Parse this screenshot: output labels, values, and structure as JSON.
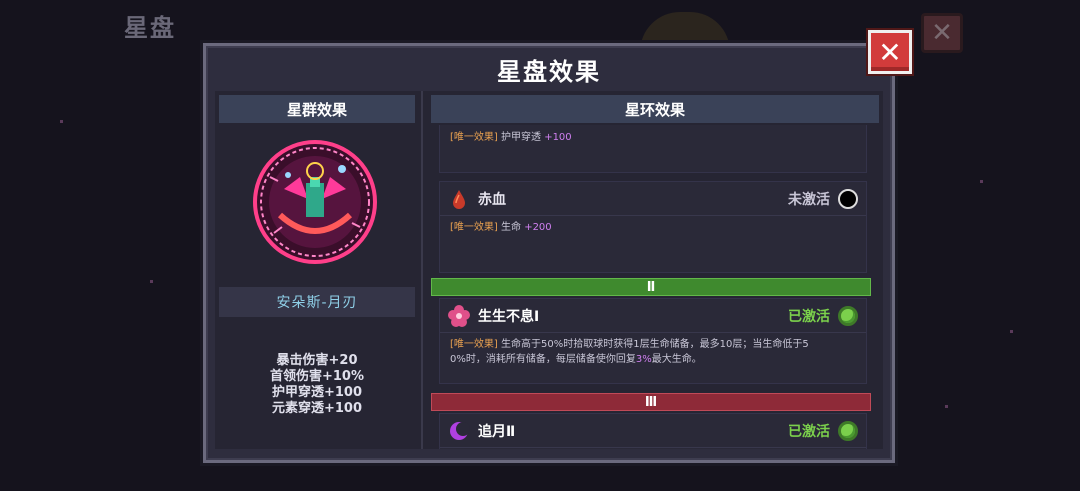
{
  "background": {
    "title": "星盘",
    "close_label": "✕"
  },
  "panel": {
    "title": "星盘效果",
    "close_label": "✕"
  },
  "left": {
    "header": "星群效果",
    "constellation_name": "安朵斯-月刃",
    "stats": [
      "暴击伤害+20",
      "首领伤害+10%",
      "护甲穿透+100",
      "元素穿透+100"
    ]
  },
  "right": {
    "header": "星环效果",
    "partial_entry": {
      "tag": "[唯一效果]",
      "text": "护甲穿透",
      "value": "+100"
    },
    "entries": [
      {
        "icon": "blood-drop-icon",
        "name": "赤血",
        "status": "未激活",
        "active": false,
        "tag": "[唯一效果]",
        "text": "生命",
        "value": "+200"
      },
      {
        "icon": "flower-icon",
        "name": "生生不息Ⅰ",
        "status": "已激活",
        "active": true,
        "tag": "[唯一效果]",
        "line1": "生命高于50%时拾取球时获得1层生命储备，最多10层；当生命低于5",
        "line2_a": "0%时，消耗所有储备，每层储备使你回复",
        "line2_hl": "3%",
        "line2_b": "最大生命。"
      },
      {
        "icon": "crescent-moon-icon",
        "name": "追月Ⅱ",
        "status": "已激活",
        "active": true
      }
    ],
    "tiers": [
      "Ⅱ",
      "Ⅲ"
    ]
  },
  "colors": {
    "active_status": "#7bd04c",
    "inactive_status": "#c8c6d6",
    "tier_ii": "#3f8a2e",
    "tier_iii": "#8e2a38",
    "highlight": "#d080f0",
    "tag": "#e8a050"
  }
}
